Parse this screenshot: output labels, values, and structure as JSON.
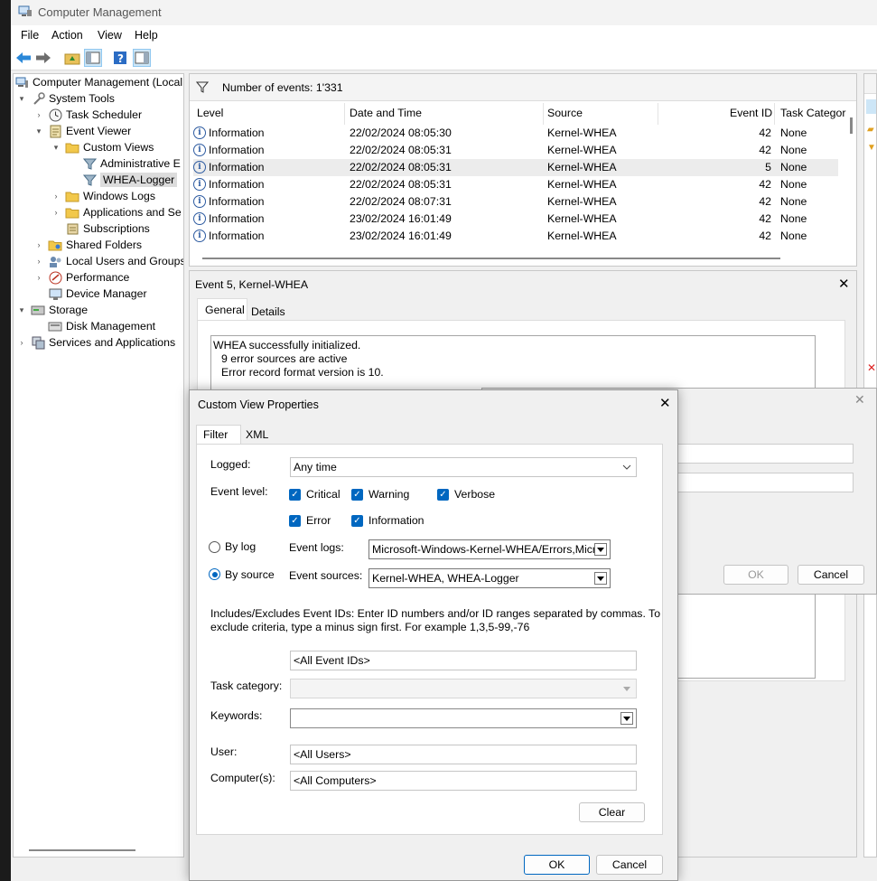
{
  "window": {
    "title": "Computer Management"
  },
  "menu": {
    "file": "File",
    "action": "Action",
    "view": "View",
    "help": "Help"
  },
  "tree": [
    {
      "label": "Computer Management (Local",
      "level": 0,
      "expander": "",
      "icon": "computer-icon"
    },
    {
      "label": "System Tools",
      "level": 1,
      "expander": "▾",
      "icon": "tools-icon"
    },
    {
      "label": "Task Scheduler",
      "level": 2,
      "expander": "›",
      "icon": "clock-icon"
    },
    {
      "label": "Event Viewer",
      "level": 2,
      "expander": "▾",
      "icon": "event-viewer-icon"
    },
    {
      "label": "Custom Views",
      "level": 3,
      "expander": "▾",
      "icon": "folder-icon"
    },
    {
      "label": "Administrative E",
      "level": 4,
      "expander": "",
      "icon": "filter-icon"
    },
    {
      "label": "WHEA-Logger",
      "level": 4,
      "expander": "",
      "icon": "filter-icon",
      "selected": true
    },
    {
      "label": "Windows Logs",
      "level": 3,
      "expander": "›",
      "icon": "folder-icon"
    },
    {
      "label": "Applications and Se",
      "level": 3,
      "expander": "›",
      "icon": "folder-icon"
    },
    {
      "label": "Subscriptions",
      "level": 3,
      "expander": "",
      "icon": "subscriptions-icon"
    },
    {
      "label": "Shared Folders",
      "level": 2,
      "expander": "›",
      "icon": "shared-folder-icon"
    },
    {
      "label": "Local Users and Groups",
      "level": 2,
      "expander": "›",
      "icon": "users-icon"
    },
    {
      "label": "Performance",
      "level": 2,
      "expander": "›",
      "icon": "performance-icon"
    },
    {
      "label": "Device Manager",
      "level": 2,
      "expander": "",
      "icon": "device-manager-icon"
    },
    {
      "label": "Storage",
      "level": 1,
      "expander": "▾",
      "icon": "storage-icon"
    },
    {
      "label": "Disk Management",
      "level": 2,
      "expander": "",
      "icon": "disk-icon"
    },
    {
      "label": "Services and Applications",
      "level": 1,
      "expander": "›",
      "icon": "services-icon"
    }
  ],
  "events": {
    "count_label": "Number of events: 1'331",
    "columns": {
      "level": "Level",
      "datetime": "Date and Time",
      "source": "Source",
      "eventid": "Event ID",
      "task": "Task Categor"
    },
    "rows": [
      {
        "level": "Information",
        "datetime": "22/02/2024 08:05:30",
        "source": "Kernel-WHEA",
        "eventid": "42",
        "task": "None"
      },
      {
        "level": "Information",
        "datetime": "22/02/2024 08:05:31",
        "source": "Kernel-WHEA",
        "eventid": "42",
        "task": "None"
      },
      {
        "level": "Information",
        "datetime": "22/02/2024 08:05:31",
        "source": "Kernel-WHEA",
        "eventid": "5",
        "task": "None",
        "selected": true
      },
      {
        "level": "Information",
        "datetime": "22/02/2024 08:05:31",
        "source": "Kernel-WHEA",
        "eventid": "42",
        "task": "None"
      },
      {
        "level": "Information",
        "datetime": "22/02/2024 08:07:31",
        "source": "Kernel-WHEA",
        "eventid": "42",
        "task": "None"
      },
      {
        "level": "Information",
        "datetime": "23/02/2024 16:01:49",
        "source": "Kernel-WHEA",
        "eventid": "42",
        "task": "None"
      },
      {
        "level": "Information",
        "datetime": "23/02/2024 16:01:49",
        "source": "Kernel-WHEA",
        "eventid": "42",
        "task": "None"
      }
    ]
  },
  "detail": {
    "title": "Event 5, Kernel-WHEA",
    "tab_general": "General",
    "tab_details": "Details",
    "line1": "WHEA successfully initialized.",
    "line2": "9 error sources are active",
    "line3": "Error record format version is 10."
  },
  "behind_dialog": {
    "ok": "OK",
    "cancel": "Cancel"
  },
  "dialog": {
    "title": "Custom View Properties",
    "tab_filter": "Filter",
    "tab_xml": "XML",
    "logged_label": "Logged:",
    "logged_value": "Any time",
    "event_level_label": "Event level:",
    "levels": {
      "critical": "Critical",
      "warning": "Warning",
      "verbose": "Verbose",
      "error": "Error",
      "information": "Information"
    },
    "by_log": "By log",
    "by_source": "By source",
    "event_logs_label": "Event logs:",
    "event_logs_value": "Microsoft-Windows-Kernel-WHEA/Errors,Micr",
    "event_sources_label": "Event sources:",
    "event_sources_value": "Kernel-WHEA, WHEA-Logger",
    "includes_text_1": "Includes/Excludes Event IDs: Enter ID numbers and/or ID ranges separated by commas. To",
    "includes_text_2": "exclude criteria, type a minus sign first. For example 1,3,5-99,-76",
    "event_ids_value": "<All Event IDs>",
    "task_category_label": "Task category:",
    "keywords_label": "Keywords:",
    "user_label": "User:",
    "user_value": "<All Users>",
    "computers_label": "Computer(s):",
    "computers_value": "<All Computers>",
    "clear": "Clear",
    "ok": "OK",
    "cancel": "Cancel"
  }
}
